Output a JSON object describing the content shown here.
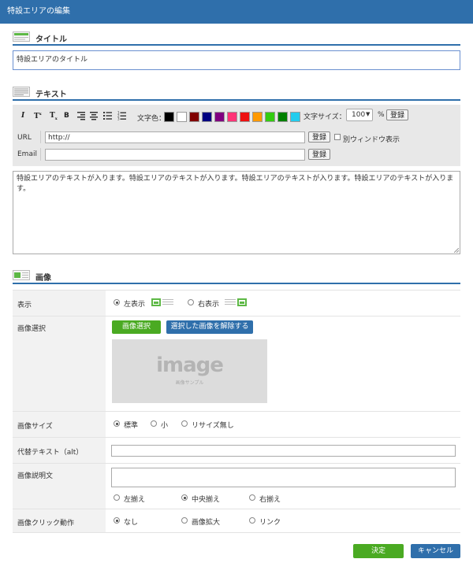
{
  "window": {
    "title": "特設エリアの編集"
  },
  "title_section": {
    "heading": "タイトル",
    "value": "特設エリアのタイトル"
  },
  "text_section": {
    "heading": "テキスト",
    "toolbar": {
      "italic": "I",
      "superscript": "T",
      "subscript": "T",
      "bold": "B",
      "text_color_label": "文字色：",
      "colors": [
        "#000000",
        "#ffffff",
        "#800000",
        "#000080",
        "#800080",
        "#ff3377",
        "#ee1111",
        "#ff9900",
        "#33cc11",
        "#008000",
        "#22ccee"
      ],
      "font_size_label": "文字サイズ：",
      "font_size_value": "100",
      "percent": "%",
      "register": "登録"
    },
    "url": {
      "label": "URL",
      "value": "http://",
      "register": "登録",
      "new_window": "別ウィンドウ表示"
    },
    "email": {
      "label": "Email",
      "value": "",
      "register": "登録"
    },
    "body": "特設エリアのテキストが入ります。特設エリアのテキストが入ります。特設エリアのテキストが入ります。特設エリアのテキストが入ります。"
  },
  "image_section": {
    "heading": "画像",
    "display": {
      "label": "表示",
      "left": "左表示",
      "right": "右表示"
    },
    "select": {
      "label": "画像選択",
      "select_btn": "画像選択",
      "clear_btn": "選択した画像を解除する",
      "placeholder_word": "image",
      "placeholder_sub": "画像サンプル"
    },
    "size": {
      "label": "画像サイズ",
      "standard": "標準",
      "small": "小",
      "no_resize": "リサイズ無し"
    },
    "alt": {
      "label": "代替テキスト（alt）",
      "value": ""
    },
    "caption": {
      "label": "画像説明文",
      "value": "",
      "left": "左揃え",
      "center": "中央揃え",
      "right": "右揃え"
    },
    "click": {
      "label": "画像クリック動作",
      "none": "なし",
      "zoom": "画像拡大",
      "link": "リンク"
    }
  },
  "footer": {
    "ok": "決定",
    "cancel": "キャンセル"
  }
}
